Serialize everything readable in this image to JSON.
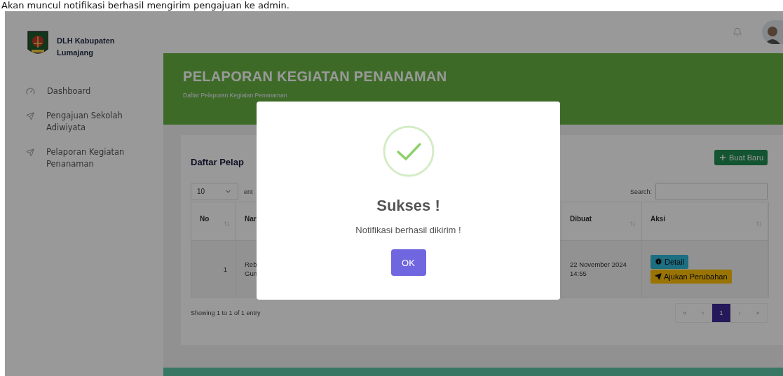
{
  "caption": "Akan muncul notifikasi berhasil mengirim pengajuan ke admin.",
  "sidebar": {
    "brand": "DLH Kabupaten Lumajang",
    "items": [
      {
        "label": "Dashboard",
        "kind": "gauge"
      },
      {
        "label": "Pengajuan Sekolah Adiwiyata",
        "kind": "send"
      },
      {
        "label": "Pelaporan Kegiatan Penanaman",
        "kind": "send"
      }
    ]
  },
  "banner": {
    "title": "PELAPORAN KEGIATAN PENANAMAN",
    "subtitle": "Daftar Pelaporan Kegiatan Penanaman"
  },
  "card": {
    "title": "Daftar Pelap",
    "create_button": "Buat Baru",
    "page_length": "10",
    "length_label": "ent",
    "search_label": "Search:",
    "table": {
      "columns": [
        "No",
        "Nar",
        "Dibuat",
        "Aksi"
      ],
      "rows": [
        {
          "no": "1",
          "name_lines": [
            "Reb",
            "Gun"
          ],
          "created": "22 November 2024 14:55",
          "actions": [
            {
              "label": "Detail",
              "kind": "detail"
            },
            {
              "label": "Ajukan Perubahan",
              "kind": "submit"
            }
          ]
        }
      ]
    },
    "info": "Showing 1 to 1 of 1 entry",
    "pagination": [
      {
        "label": "«",
        "selected": false
      },
      {
        "label": "‹",
        "selected": false
      },
      {
        "label": "1",
        "selected": true
      },
      {
        "label": "›",
        "selected": false
      },
      {
        "label": "»",
        "selected": false
      }
    ]
  },
  "modal": {
    "kind": "success",
    "title": "Sukses !",
    "text": "Notifikasi berhasil dikirim !",
    "button": "OK"
  }
}
